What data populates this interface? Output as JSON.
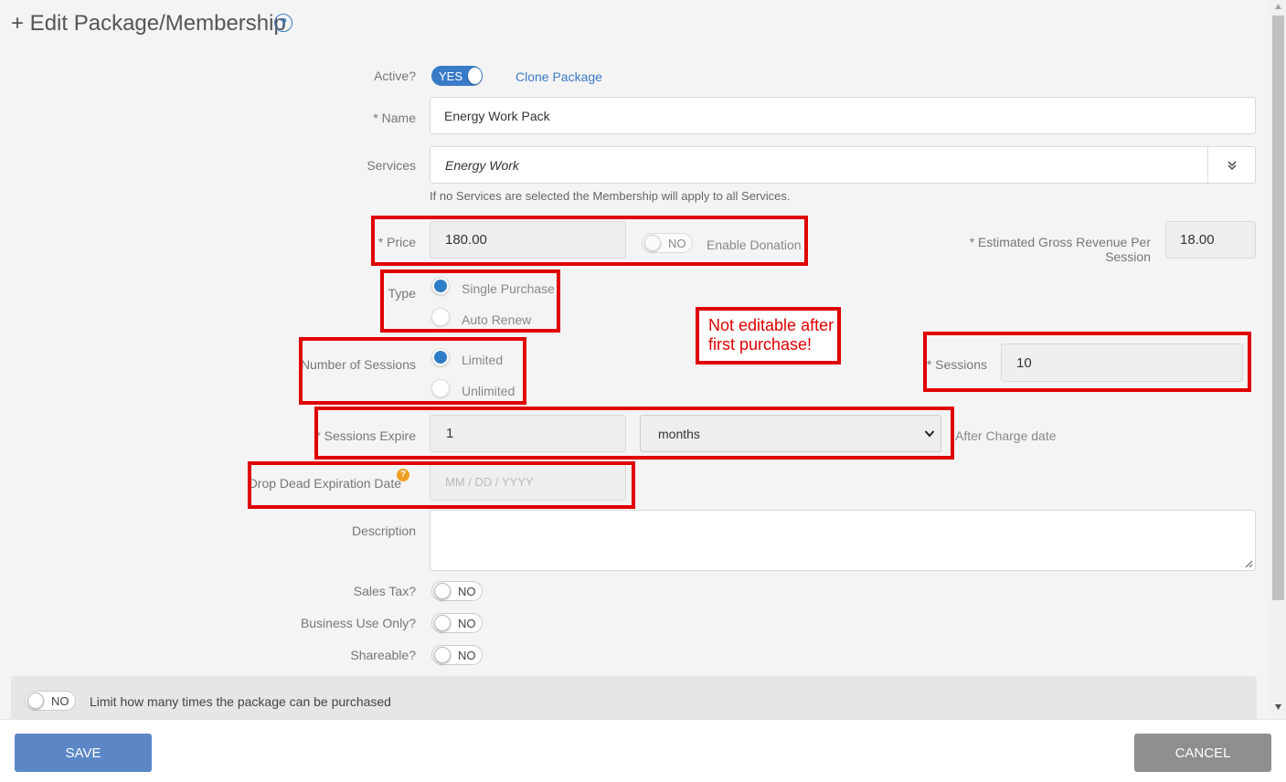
{
  "header": {
    "title": "+ Edit Package/Membership",
    "help_icon": "?"
  },
  "active": {
    "label": "Active?",
    "toggle": "YES",
    "clone_link": "Clone Package"
  },
  "name": {
    "label": "* Name",
    "value": "Energy Work Pack"
  },
  "services": {
    "label": "Services",
    "value": "Energy Work",
    "hint": "If no Services are selected the Membership will apply to all Services."
  },
  "price": {
    "label": "* Price",
    "value": "180.00",
    "donation_toggle": "NO",
    "donation_label": "Enable Donation"
  },
  "revenue": {
    "label_line1": "* Estimated Gross Revenue Per",
    "label_line2": "Session",
    "value": "18.00"
  },
  "type": {
    "label": "Type",
    "options": [
      "Single Purchase",
      "Auto Renew"
    ]
  },
  "note": {
    "line1": "Not editable after",
    "line2": "first purchase!"
  },
  "num_sessions": {
    "label": "Number of Sessions",
    "options": [
      "Limited",
      "Unlimited"
    ]
  },
  "sessions": {
    "label": "* Sessions",
    "value": "10"
  },
  "expire": {
    "label": "* Sessions Expire",
    "value": "1",
    "unit": "months",
    "suffix": "After Charge date"
  },
  "drop_dead": {
    "label": "Drop Dead Expiration Date",
    "placeholder": "MM / DD / YYYY"
  },
  "description": {
    "label": "Description",
    "value": ""
  },
  "sales_tax": {
    "label": "Sales Tax?",
    "toggle": "NO"
  },
  "business_use": {
    "label": "Business Use Only?",
    "toggle": "NO"
  },
  "shareable": {
    "label": "Shareable?",
    "toggle": "NO"
  },
  "limit": {
    "toggle": "NO",
    "label": "Limit how many times the package can be purchased"
  },
  "footer": {
    "save": "SAVE",
    "cancel": "CANCEL"
  },
  "colors": {
    "accent": "#3a7bc8",
    "annotation": "#e00000",
    "save": "#5b87c7",
    "cancel": "#8f8f8f"
  }
}
